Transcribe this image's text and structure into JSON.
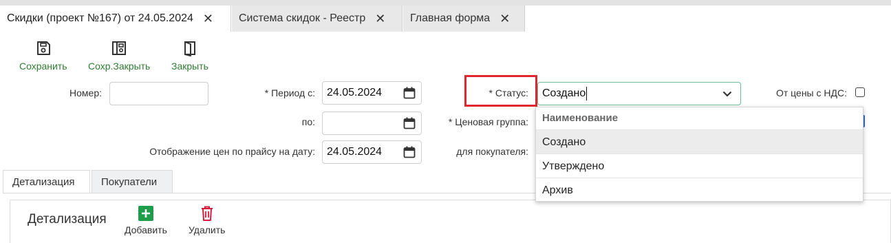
{
  "tabs": [
    {
      "label": "Скидки (проект №167) от 24.05.2024",
      "active": true
    },
    {
      "label": "Система скидок - Реестр",
      "active": false
    },
    {
      "label": "Главная форма",
      "active": false
    }
  ],
  "toolbar": {
    "save": "Сохранить",
    "save_close": "Сохр.Закрыть",
    "close": "Закрыть"
  },
  "form": {
    "number_label": "Номер:",
    "number_value": "",
    "period_from_label": "* Период с:",
    "period_from_value": "24.05.2024",
    "period_to_label": "по:",
    "period_to_value": "",
    "price_display_label": "Отображение цен по прайсу на дату:",
    "price_display_value": "24.05.2024",
    "status_label": "* Статус:",
    "status_value": "Создано",
    "price_group_label": "* Ценовая группа:",
    "buyer_label": "для покупателя:",
    "vat_label": "От цены с НДС:"
  },
  "status_dropdown": {
    "header": "Наименование",
    "options": [
      "Создано",
      "Утверждено",
      "Архив"
    ],
    "selected": "Создано"
  },
  "bottom_tabs": [
    {
      "label": "Детализация",
      "active": true
    },
    {
      "label": "Покупатели",
      "active": false
    }
  ],
  "detail_panel": {
    "title": "Детализация",
    "add": "Добавить",
    "delete": "Удалить"
  },
  "colors": {
    "accent_green": "#2e7d32",
    "highlight_red": "#e0262e",
    "add_green": "#1e9e4a",
    "delete_red": "#d81b3a"
  }
}
